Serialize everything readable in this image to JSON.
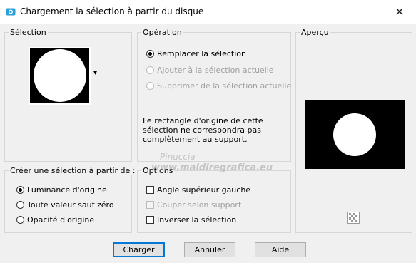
{
  "window": {
    "title": "Chargement la sélection à partir du disque",
    "close_glyph": "✕"
  },
  "selection_group": {
    "label": "Sélection",
    "dropdown_glyph": "▾"
  },
  "operation_group": {
    "label": "Opération",
    "options": [
      {
        "label": "Remplacer la sélection",
        "checked": true,
        "enabled": true
      },
      {
        "label": "Ajouter à la sélection actuelle",
        "checked": false,
        "enabled": false
      },
      {
        "label": "Supprimer de la sélection actuelle",
        "checked": false,
        "enabled": false
      }
    ],
    "message": [
      "Le rectangle d'origine de cette",
      "sélection ne correspondra pas",
      "complètement au support."
    ]
  },
  "preview_group": {
    "label": "Aperçu"
  },
  "create_from_group": {
    "label": "Créer une sélection à partir de :",
    "options": [
      {
        "label": "Luminance d'origine",
        "checked": true
      },
      {
        "label": "Toute valeur sauf zéro",
        "checked": false
      },
      {
        "label": "Opacité d'origine",
        "checked": false
      }
    ]
  },
  "options_group": {
    "label": "Options",
    "items": [
      {
        "label": "Angle supérieur gauche",
        "checked": false,
        "enabled": true
      },
      {
        "label": "Couper selon support",
        "checked": false,
        "enabled": false
      },
      {
        "label": "Inverser la sélection",
        "checked": false,
        "enabled": true
      }
    ]
  },
  "buttons": {
    "load": "Charger",
    "cancel": "Annuler",
    "help": "Aide"
  },
  "watermark": {
    "line1": "Pinuccia",
    "line2": "www.maidiregrafica.eu"
  },
  "colors": {
    "accent": "#0078d7",
    "border": "#d6d6d6",
    "bg": "#f0f0f0"
  }
}
